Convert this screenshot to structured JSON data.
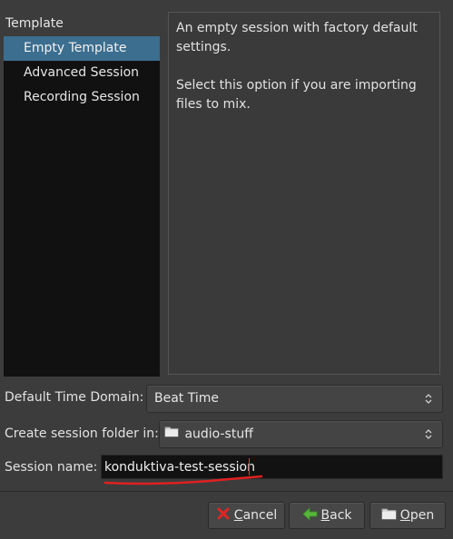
{
  "template": {
    "header": "Template",
    "items": [
      {
        "label": "Empty Template",
        "selected": true
      },
      {
        "label": "Advanced Session",
        "selected": false
      },
      {
        "label": "Recording Session",
        "selected": false
      }
    ]
  },
  "description": {
    "line1": "An empty session with factory default settings.",
    "line2": "Select this option if you are importing files to mix."
  },
  "form": {
    "time_domain_label": "Default Time Domain:",
    "time_domain_value": "Beat Time",
    "folder_label": "Create session folder in:",
    "folder_value": "audio-stuff",
    "session_name_label": "Session name:",
    "session_name_value": "konduktiva-test-session"
  },
  "buttons": {
    "cancel_mnemonic": "C",
    "cancel_rest": "ancel",
    "back_mnemonic": "B",
    "back_rest": "ack",
    "open_mnemonic": "O",
    "open_rest": "pen"
  },
  "colors": {
    "selection": "#3b6e8f",
    "annotation": "#e02020",
    "back_arrow": "#56b53a"
  },
  "icons": {
    "cancel": "red-x-icon",
    "back": "green-left-arrow-icon",
    "open": "folder-icon",
    "folder": "folder-icon",
    "combo": "up-down-chevron-icon"
  }
}
